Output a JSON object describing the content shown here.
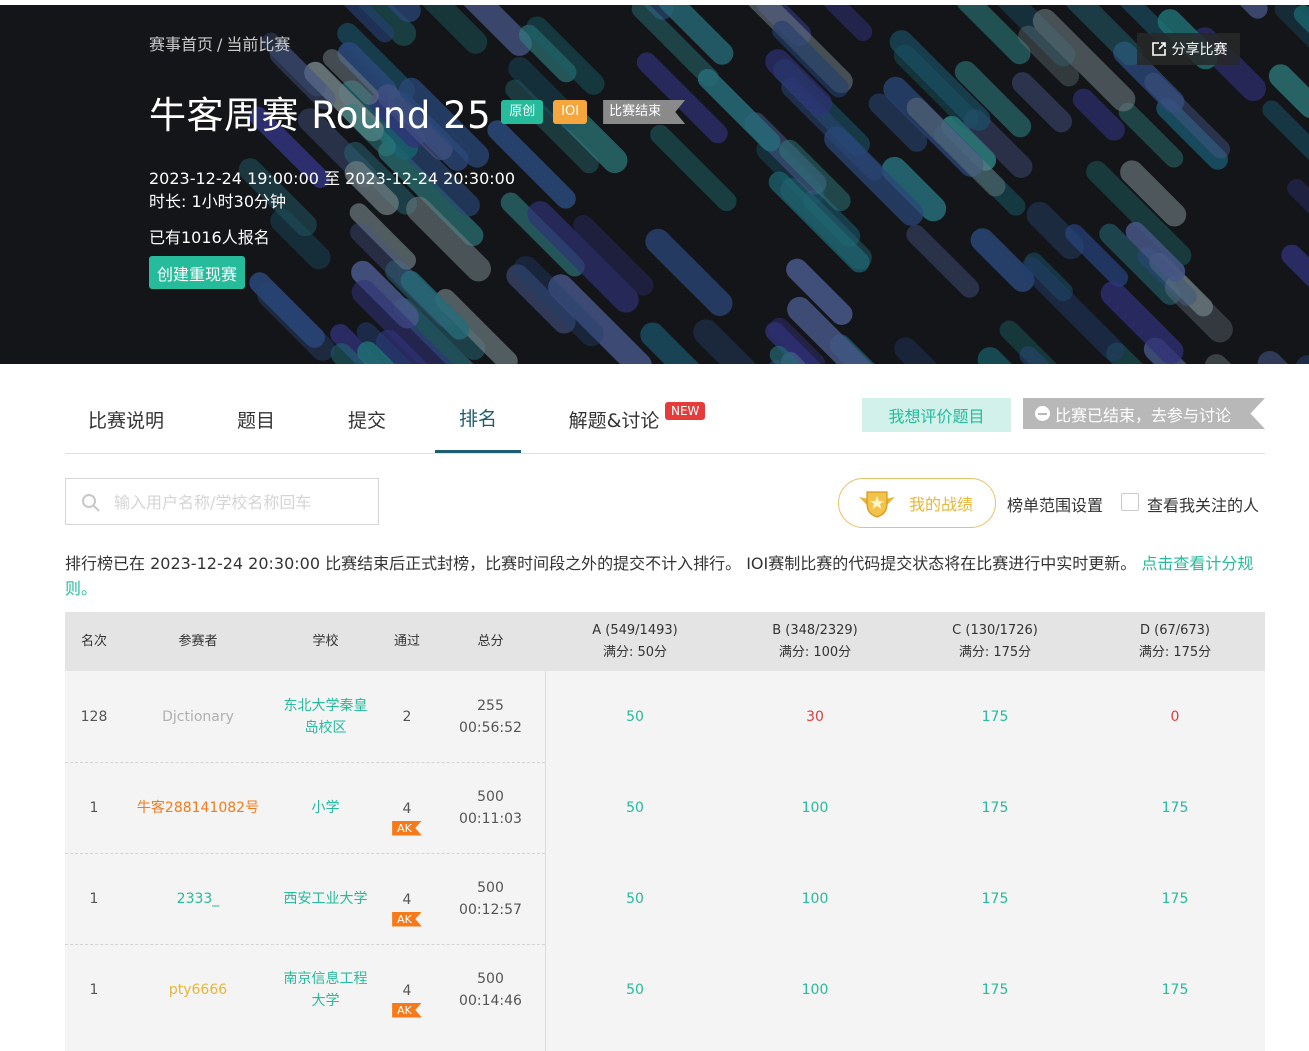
{
  "breadcrumb": {
    "home": "赛事首页",
    "separator": "/",
    "current": "当前比赛"
  },
  "share_label": "分享比赛",
  "contest": {
    "title": "牛客周赛 Round 25",
    "tags": {
      "original": "原创",
      "ioi": "IOI",
      "ended": "比赛结束"
    },
    "time_range": "2023-12-24 19:00:00 至 2023-12-24 20:30:00",
    "duration": "时长: 1小时30分钟",
    "signup": "已有1016人报名",
    "replay_button": "创建重现赛"
  },
  "tabs": [
    {
      "label": "比赛说明",
      "active": false
    },
    {
      "label": "题目",
      "active": false
    },
    {
      "label": "提交",
      "active": false
    },
    {
      "label": "排名",
      "active": true
    },
    {
      "label": "解题&讨论",
      "active": false
    }
  ],
  "new_badge": "NEW",
  "rate_button": "我想评价题目",
  "ended_discuss_button": "比赛已结束，去参与讨论",
  "search": {
    "placeholder": "输入用户名称/学校名称回车",
    "value": ""
  },
  "my_record": "我的战绩",
  "range_setting": "榜单范围设置",
  "follow_label": "查看我关注的人",
  "follow_checked": false,
  "notice": {
    "text": "排行榜已在 2023-12-24 20:30:00 比赛结束后正式封榜，比赛时间段之外的提交不计入排行。 IOI赛制比赛的代码提交状态将在比赛进行中实时更新。",
    "link": "点击查看计分规则。"
  },
  "table": {
    "headers": {
      "rank": "名次",
      "participant": "参赛者",
      "school": "学校",
      "passed": "通过",
      "score": "总分",
      "problems": [
        {
          "title": "A (549/1493)",
          "full": "满分: 50分"
        },
        {
          "title": "B (348/2329)",
          "full": "满分: 100分"
        },
        {
          "title": "C (130/1726)",
          "full": "满分: 175分"
        },
        {
          "title": "D (67/673)",
          "full": "满分: 175分"
        }
      ]
    },
    "rows": [
      {
        "rank": "128",
        "name": "Djctionary",
        "name_color": "#b0b0b0",
        "school": "东北大学秦皇岛校区",
        "school_lines": [
          "东北大学秦皇",
          "岛校区"
        ],
        "passed": "2",
        "ak": "",
        "score": "255",
        "time": "00:56:52",
        "scores": [
          {
            "v": "50",
            "c": "ok"
          },
          {
            "v": "30",
            "c": "bad"
          },
          {
            "v": "175",
            "c": "ok"
          },
          {
            "v": "0",
            "c": "bad"
          }
        ]
      },
      {
        "rank": "1",
        "name": "牛客288141082号",
        "name_color": "#f57a1b",
        "school": "小学",
        "school_lines": [
          "小学"
        ],
        "passed": "4",
        "ak": "AK",
        "score": "500",
        "time": "00:11:03",
        "scores": [
          {
            "v": "50",
            "c": "ok"
          },
          {
            "v": "100",
            "c": "ok"
          },
          {
            "v": "175",
            "c": "ok"
          },
          {
            "v": "175",
            "c": "ok"
          }
        ]
      },
      {
        "rank": "1",
        "name": "2333_",
        "name_color": "#25bb9b",
        "school": "西安工业大学",
        "school_lines": [
          "西安工业大学"
        ],
        "passed": "4",
        "ak": "AK",
        "score": "500",
        "time": "00:12:57",
        "scores": [
          {
            "v": "50",
            "c": "ok"
          },
          {
            "v": "100",
            "c": "ok"
          },
          {
            "v": "175",
            "c": "ok"
          },
          {
            "v": "175",
            "c": "ok"
          }
        ]
      },
      {
        "rank": "1",
        "name": "pty6666",
        "name_color": "#e8b63a",
        "school": "南京信息工程大学",
        "school_lines": [
          "南京信息工程",
          "大学"
        ],
        "passed": "4",
        "ak": "AK",
        "score": "500",
        "time": "00:14:46",
        "scores": [
          {
            "v": "50",
            "c": "ok"
          },
          {
            "v": "100",
            "c": "ok"
          },
          {
            "v": "175",
            "c": "ok"
          },
          {
            "v": "175",
            "c": "ok"
          }
        ]
      }
    ]
  }
}
